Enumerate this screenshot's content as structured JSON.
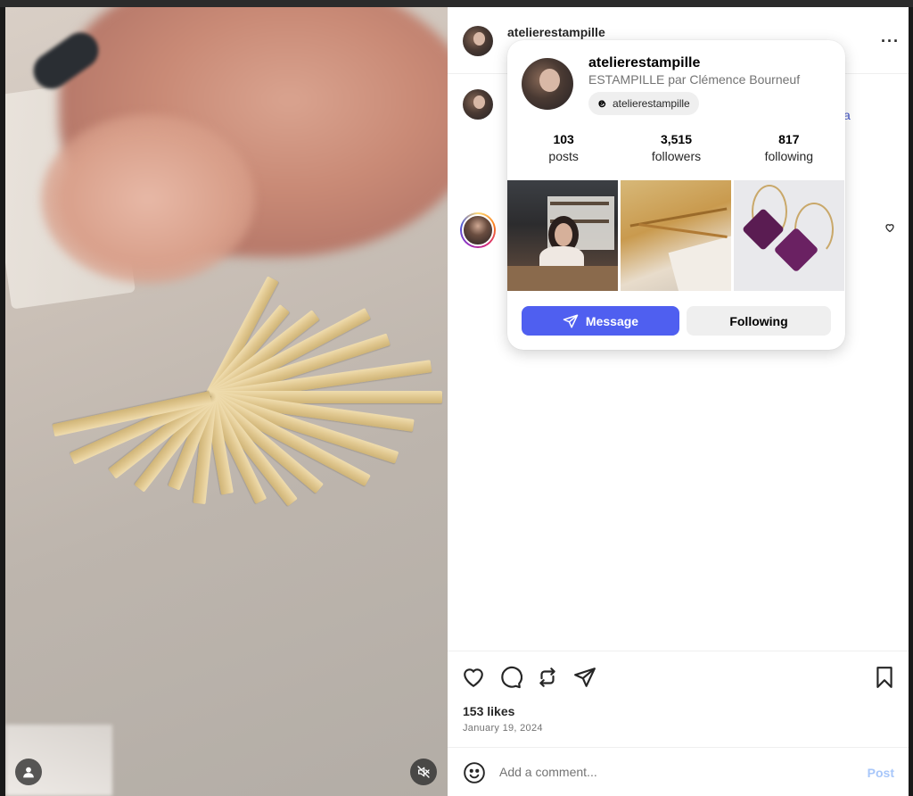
{
  "post": {
    "username": "atelierestampille",
    "more_label": "···",
    "caption_fragment": "a",
    "likes": "153 likes",
    "date": "January 19, 2024"
  },
  "comment": {
    "placeholder": "Add a comment...",
    "post_label": "Post"
  },
  "hover_card": {
    "username": "atelierestampille",
    "full_name": "ESTAMPILLE par Clémence Bourneuf",
    "threads_handle": "atelierestampille",
    "stats": [
      {
        "count": "103",
        "label": "posts"
      },
      {
        "count": "3,515",
        "label": "followers"
      },
      {
        "count": "817",
        "label": "following"
      }
    ],
    "message_label": "Message",
    "following_label": "Following"
  },
  "icons": {
    "media_left": "user-icon",
    "media_right": "muted-speaker-icon",
    "actions": [
      "heart-icon",
      "comment-icon",
      "repost-icon",
      "share-icon",
      "bookmark-icon"
    ],
    "comment": "emoji-icon"
  },
  "colors": {
    "accent": "#4f5ff0",
    "link": "#4355c7",
    "post_disabled": "#a8c7fa"
  }
}
